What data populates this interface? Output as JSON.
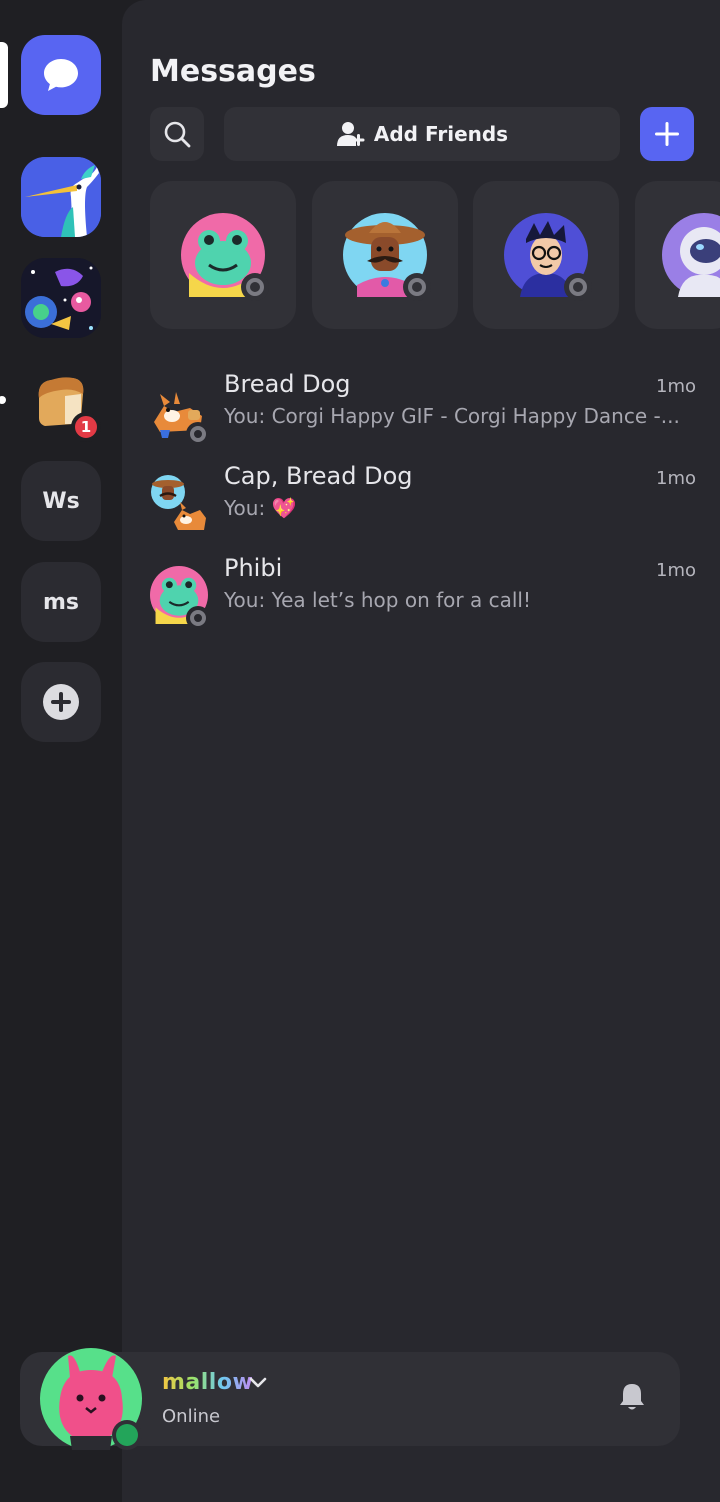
{
  "header": {
    "title": "Messages",
    "add_friends_label": "Add Friends"
  },
  "servers": [
    {
      "kind": "dm",
      "icon": "chat-bubble-icon",
      "selected": true
    },
    {
      "kind": "image",
      "icon": "heron-icon"
    },
    {
      "kind": "image",
      "icon": "space-art-icon"
    },
    {
      "kind": "image",
      "icon": "bread-icon",
      "badge": "1",
      "unread": true
    },
    {
      "kind": "text",
      "label": "Ws"
    },
    {
      "kind": "text",
      "label": "ms"
    },
    {
      "kind": "add",
      "icon": "plus-circle-icon"
    }
  ],
  "friends": [
    {
      "avatar": "frog-avatar",
      "status": "offline"
    },
    {
      "avatar": "mustache-avatar",
      "status": "offline"
    },
    {
      "avatar": "glasses-avatar",
      "status": "offline"
    },
    {
      "avatar": "astronaut-avatar",
      "status": "offline"
    }
  ],
  "dms": [
    {
      "name": "Bread Dog",
      "preview": "You: Corgi Happy GIF - Corgi Happy Dance -...",
      "time": "1mo",
      "avatar": "corgi-avatar"
    },
    {
      "name": "Cap, Bread Dog",
      "preview": "You: 💖",
      "time": "1mo",
      "avatar": "group-avatar"
    },
    {
      "name": "Phibi",
      "preview": "You: Yea let’s hop on for a call!",
      "time": "1mo",
      "avatar": "frog-avatar"
    }
  ],
  "user": {
    "name": "mallow",
    "status": "Online",
    "status_color": "#23a55a"
  },
  "colors": {
    "accent": "#5865f2",
    "badge": "#e23a45"
  }
}
